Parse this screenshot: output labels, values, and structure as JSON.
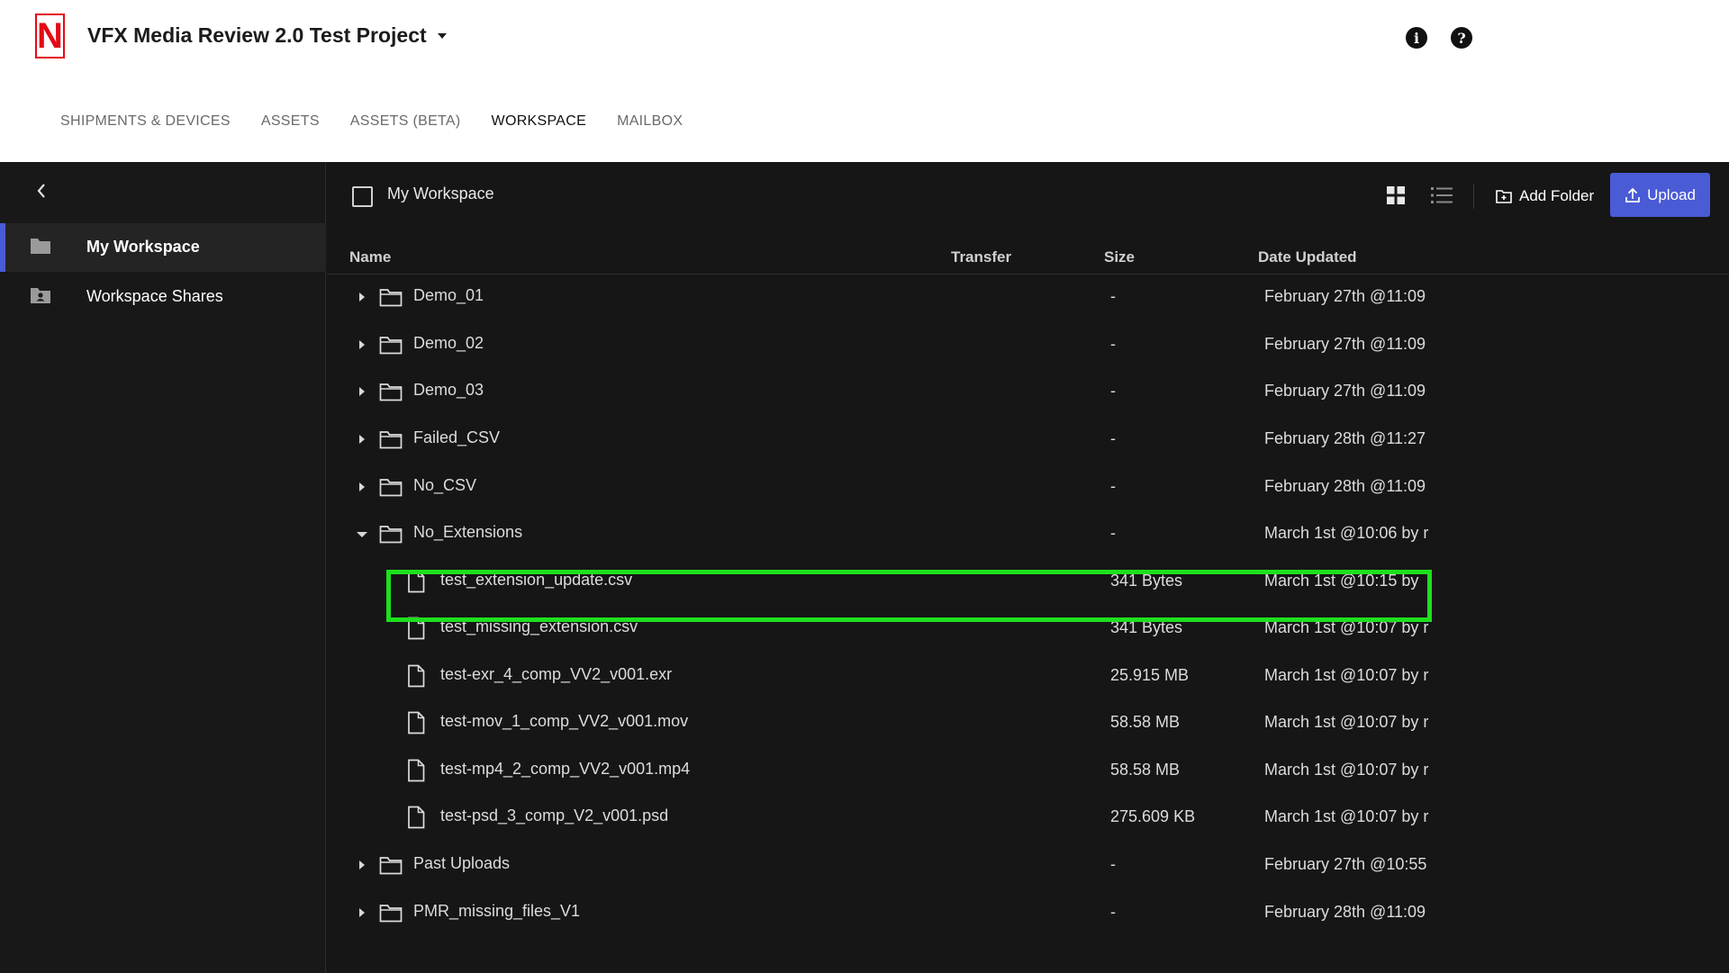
{
  "header": {
    "logo_letter": "N",
    "project_title": "VFX Media Review 2.0 Test Project",
    "info_icon": "info-icon",
    "help_icon": "help-icon",
    "info_glyph": "i",
    "help_glyph": "?"
  },
  "nav": {
    "items": [
      {
        "label": "SHIPMENTS & DEVICES"
      },
      {
        "label": "ASSETS"
      },
      {
        "label": "ASSETS (BETA)"
      },
      {
        "label": "WORKSPACE",
        "active": true
      },
      {
        "label": "MAILBOX"
      }
    ]
  },
  "sidebar": {
    "items": [
      {
        "label": "My Workspace",
        "icon": "folder-icon",
        "active": true
      },
      {
        "label": "Workspace Shares",
        "icon": "shared-folder-icon"
      }
    ]
  },
  "toolbar": {
    "breadcrumb": "My Workspace",
    "add_folder_label": "Add Folder",
    "upload_label": "Upload"
  },
  "table": {
    "columns": [
      "Name",
      "Transfer",
      "Size",
      "Date Updated"
    ],
    "rows": [
      {
        "type": "folder",
        "name": "Demo_01",
        "size": "-",
        "date": "February 27th @11:09",
        "expanded": false
      },
      {
        "type": "folder",
        "name": "Demo_02",
        "size": "-",
        "date": "February 27th @11:09",
        "expanded": false
      },
      {
        "type": "folder",
        "name": "Demo_03",
        "size": "-",
        "date": "February 27th @11:09",
        "expanded": false
      },
      {
        "type": "folder",
        "name": "Failed_CSV",
        "size": "-",
        "date": "February 28th @11:27",
        "expanded": false
      },
      {
        "type": "folder",
        "name": "No_CSV",
        "size": "-",
        "date": "February 28th @11:09",
        "expanded": false
      },
      {
        "type": "folder",
        "name": "No_Extensions",
        "size": "-",
        "date": "March 1st @10:06 by r",
        "expanded": true
      },
      {
        "type": "file",
        "name": "test_extension_update.csv",
        "size": "341 Bytes",
        "date": "March 1st @10:15 by",
        "highlighted": true
      },
      {
        "type": "file",
        "name": "test_missing_extension.csv",
        "size": "341 Bytes",
        "date": "March 1st @10:07 by r"
      },
      {
        "type": "file",
        "name": "test-exr_4_comp_VV2_v001.exr",
        "size": "25.915 MB",
        "date": "March 1st @10:07 by r"
      },
      {
        "type": "file",
        "name": "test-mov_1_comp_VV2_v001.mov",
        "size": "58.58 MB",
        "date": "March 1st @10:07 by r"
      },
      {
        "type": "file",
        "name": "test-mp4_2_comp_VV2_v001.mp4",
        "size": "58.58 MB",
        "date": "March 1st @10:07 by r"
      },
      {
        "type": "file",
        "name": "test-psd_3_comp_V2_v001.psd",
        "size": "275.609 KB",
        "date": "March 1st @10:07 by r"
      },
      {
        "type": "folder",
        "name": "Past Uploads",
        "size": "-",
        "date": "February 27th @10:55",
        "expanded": false
      },
      {
        "type": "folder",
        "name": "PMR_missing_files_V1",
        "size": "-",
        "date": "February 28th @11:09",
        "expanded": false
      }
    ]
  },
  "colors": {
    "accent": "#4a5bd6",
    "brand": "#e50914",
    "highlight": "#1de01d",
    "background": "#161616"
  }
}
